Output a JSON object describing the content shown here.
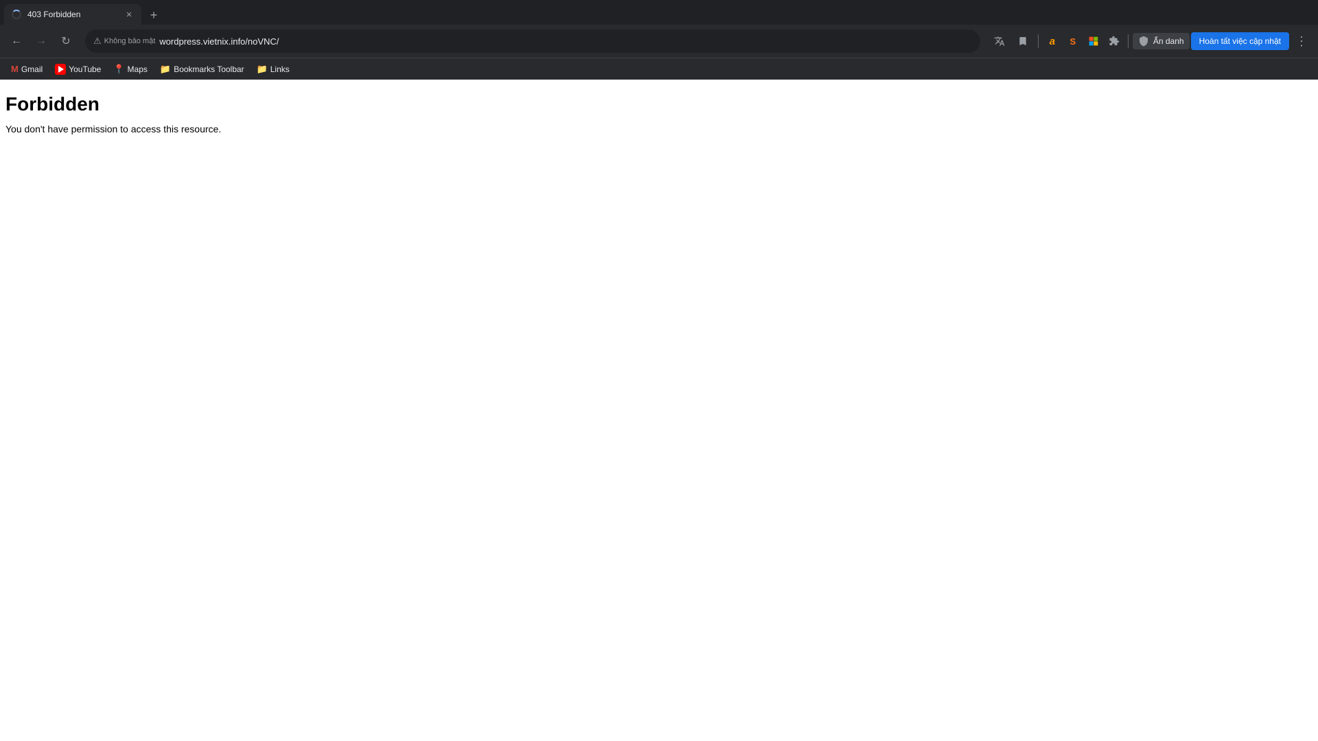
{
  "browser": {
    "tab": {
      "title": "403 Forbidden",
      "favicon_type": "spinner"
    },
    "new_tab_label": "+",
    "nav": {
      "back_disabled": false,
      "forward_disabled": true,
      "reload_title": "Reload page",
      "address": {
        "security_label": "Không bảo mật",
        "url": "wordpress.vietnix.info/noVNC/"
      }
    },
    "extensions": [
      {
        "id": "amazon-ext",
        "label": "a",
        "color": "#ff9900",
        "title": "Amazon"
      },
      {
        "id": "similarweb-ext",
        "label": "S",
        "color": "#f97316",
        "title": "SimilarWeb"
      },
      {
        "id": "microsoft-ext",
        "label": "M",
        "color": "#00a4ef",
        "title": "Microsoft"
      },
      {
        "id": "extensions-menu",
        "label": "⊞",
        "color": "#9aa0a6",
        "title": "Extensions"
      }
    ],
    "incognito": {
      "icon": "👤",
      "label": "Ẩn danh"
    },
    "update_button": "Hoàn tất việc cập nhật",
    "menu_icon": "⋮"
  },
  "bookmarks": [
    {
      "id": "gmail",
      "label": "Gmail",
      "icon_type": "gmail"
    },
    {
      "id": "youtube",
      "label": "YouTube",
      "icon_type": "youtube"
    },
    {
      "id": "maps",
      "label": "Maps",
      "icon_type": "maps"
    },
    {
      "id": "bookmarks-toolbar",
      "label": "Bookmarks Toolbar",
      "icon_type": "folder"
    },
    {
      "id": "links",
      "label": "Links",
      "icon_type": "folder"
    }
  ],
  "page": {
    "heading": "Forbidden",
    "description": "You don't have permission to access this resource."
  }
}
